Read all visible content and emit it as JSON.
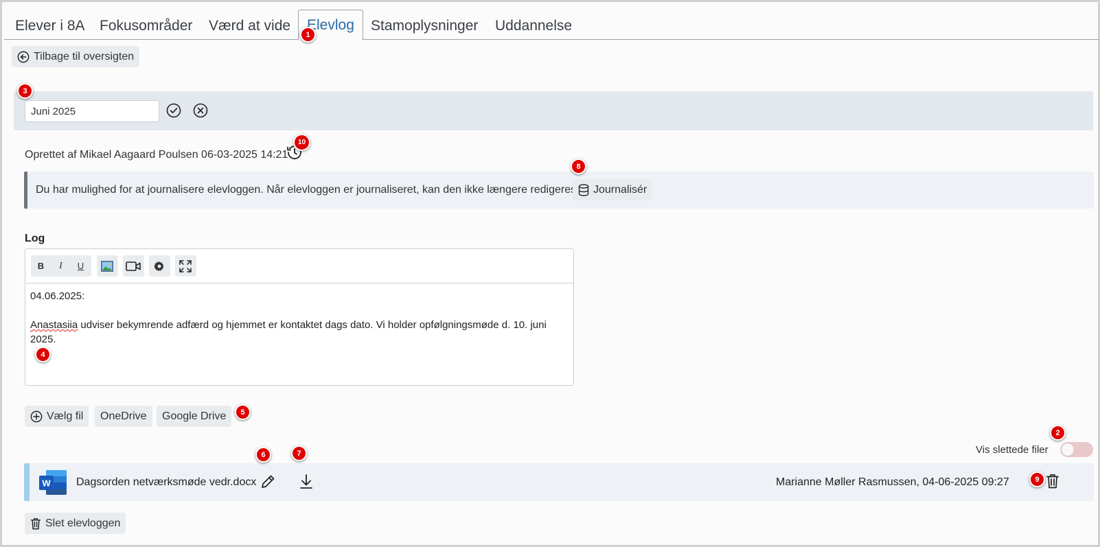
{
  "tabs": [
    {
      "label": "Elever i 8A"
    },
    {
      "label": "Fokusområder"
    },
    {
      "label": "Værd at vide"
    },
    {
      "label": "Elevlog"
    },
    {
      "label": "Stamoplysninger"
    },
    {
      "label": "Uddannelse"
    }
  ],
  "back_button": {
    "label": "Tilbage til oversigten"
  },
  "title_input": {
    "value": "Juni 2025"
  },
  "meta": {
    "created_text": "Oprettet af Mikael Aagaard Poulsen 06-03-2025 14:21"
  },
  "journal": {
    "info_text": "Du har mulighed for at journalisere elevloggen. Når elevloggen er journaliseret, kan den ikke længere redigeres.",
    "button_label": "Journalisér"
  },
  "log": {
    "label": "Log",
    "toolbar": {
      "bold": "B",
      "italic": "I",
      "underline": "U"
    },
    "content": {
      "date_line": "04.06.2025:",
      "name_word": "Anastasiia",
      "text_rest": " udviser bekymrende adfærd og hjemmet er kontaktet dags dato. Vi holder opfølgningsmøde d. 10. juni 2025."
    }
  },
  "upload": {
    "choose_file": "Vælg fil",
    "onedrive": "OneDrive",
    "google_drive": "Google Drive"
  },
  "deleted_toggle": {
    "label": "Vis slettede filer"
  },
  "file": {
    "name": "Dagsorden netværksmøde vedr.docx",
    "uploader": "Marianne Møller Rasmussen, 04-06-2025 09:27"
  },
  "delete_log": {
    "label": "Slet elevloggen"
  },
  "badges": {
    "b1": "1",
    "b2": "2",
    "b3": "3",
    "b4": "4",
    "b5": "5",
    "b6": "6",
    "b7": "7",
    "b8": "8",
    "b9": "9",
    "b10": "10"
  },
  "colors": {
    "accent": "#2a6aa8",
    "badge": "#e00000",
    "info_border": "#6e747b",
    "file_border": "#9fd0ee",
    "word_blue": "#2b579a"
  },
  "icons": {
    "back": "arrow-left-circle-icon",
    "confirm": "check-circle-icon",
    "cancel": "x-circle-icon",
    "history": "history-clock-icon",
    "database": "database-icon",
    "image": "image-icon",
    "video": "video-icon",
    "settings": "gear-icon",
    "fullscreen": "fullscreen-icon",
    "add": "plus-circle-icon",
    "word": "word-file-icon",
    "edit": "pencil-icon",
    "download": "download-icon",
    "trash": "trash-icon"
  }
}
